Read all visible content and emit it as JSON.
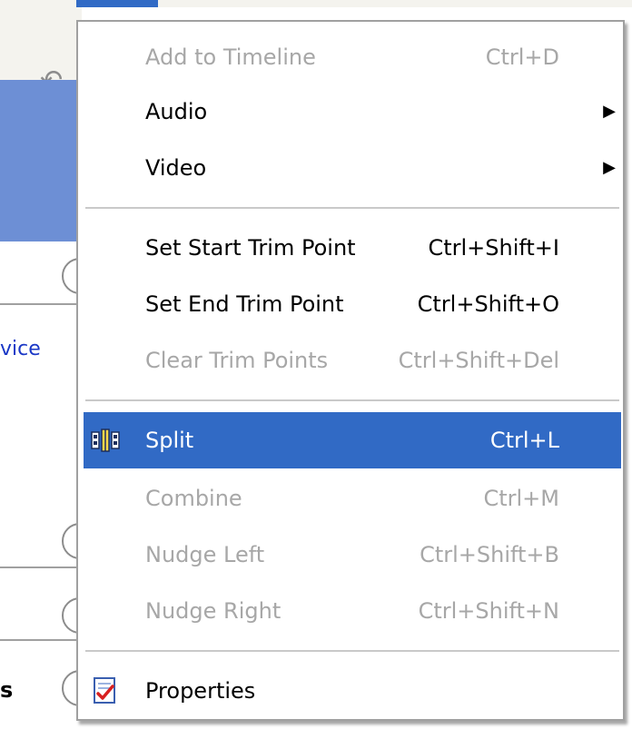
{
  "background": {
    "link_fragment": "vice",
    "bottom_fragment": "s"
  },
  "menu": {
    "items": [
      {
        "label": "Add to Timeline",
        "shortcut": "Ctrl+D",
        "enabled": false
      },
      {
        "label": "Audio",
        "shortcut": "",
        "submenu": true,
        "enabled": true
      },
      {
        "label": "Video",
        "shortcut": "",
        "submenu": true,
        "enabled": true
      },
      {
        "label": "Set Start Trim Point",
        "shortcut": "Ctrl+Shift+I",
        "enabled": true
      },
      {
        "label": "Set End Trim Point",
        "shortcut": "Ctrl+Shift+O",
        "enabled": true
      },
      {
        "label": "Clear Trim Points",
        "shortcut": "Ctrl+Shift+Del",
        "enabled": false
      },
      {
        "label": "Split",
        "shortcut": "Ctrl+L",
        "enabled": true,
        "highlighted": true,
        "icon": "split-clip-icon"
      },
      {
        "label": "Combine",
        "shortcut": "Ctrl+M",
        "enabled": false
      },
      {
        "label": "Nudge Left",
        "shortcut": "Ctrl+Shift+B",
        "enabled": false
      },
      {
        "label": "Nudge Right",
        "shortcut": "Ctrl+Shift+N",
        "enabled": false
      },
      {
        "label": "Properties",
        "shortcut": "",
        "enabled": true,
        "icon": "properties-checklist-icon"
      }
    ],
    "submenu_arrow": "▶"
  },
  "colors": {
    "highlight": "#316ac5",
    "disabled_text": "#a7a7a7",
    "background_panel": "#6d8fd5",
    "link": "#1a37c6"
  }
}
